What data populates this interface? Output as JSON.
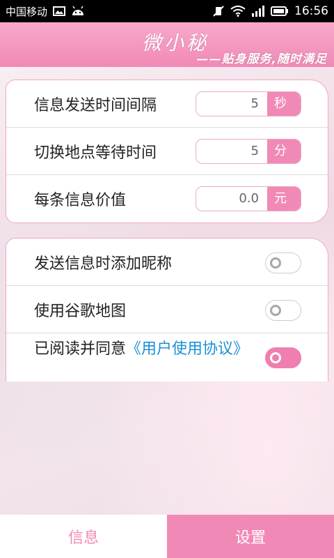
{
  "status_bar": {
    "carrier": "中国移动",
    "time": "16:56",
    "icons": [
      "image-icon",
      "android-icon",
      "mute-icon",
      "wifi-icon",
      "signal-icon",
      "battery-icon"
    ]
  },
  "header": {
    "logo": "微小秘",
    "slogan": "——贴身服务,随时满足"
  },
  "settings": {
    "interval": {
      "label": "信息发送时间间隔",
      "value": "5",
      "unit": "秒"
    },
    "wait": {
      "label": "切换地点等待时间",
      "value": "5",
      "unit": "分"
    },
    "price": {
      "label": "每条信息价值",
      "value": "0.0",
      "unit": "元"
    }
  },
  "toggles": {
    "nickname": {
      "label": "发送信息时添加昵称",
      "on": false
    },
    "google_map": {
      "label": "使用谷歌地图",
      "on": false
    },
    "agree": {
      "label": "已阅读并同意",
      "link": "《用户使用协议》",
      "on": true
    }
  },
  "tabs": {
    "info": "信息",
    "settings": "设置"
  },
  "colors": {
    "accent": "#f189b6",
    "link": "#1b8fd6"
  }
}
